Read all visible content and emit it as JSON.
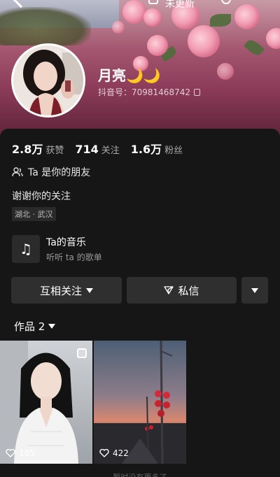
{
  "topbar": {
    "update_label": "未更新"
  },
  "profile": {
    "username": "月亮🌙🌙",
    "douyin_id": "抖音号：70981468742"
  },
  "stats": [
    {
      "value": "2.8万",
      "label": "获赞"
    },
    {
      "value": "714",
      "label": "关注"
    },
    {
      "value": "1.6万",
      "label": "粉丝"
    }
  ],
  "friend_text": "Ta 是你的朋友",
  "bio": "谢谢你的关注",
  "location": "湖北 · 武汉",
  "music": {
    "title": "Ta的音乐",
    "subtitle": "听听 ta 的歌单"
  },
  "buttons": {
    "follow": "互相关注",
    "message": "私信"
  },
  "works_tab": {
    "label": "作品 2"
  },
  "posts": [
    {
      "likes": "185"
    },
    {
      "likes": "422"
    }
  ],
  "footer_hint": "暂时没有更多了",
  "colors": {
    "background": "#161616",
    "button": "#2f2f2f",
    "header_pink": "#a45770"
  }
}
